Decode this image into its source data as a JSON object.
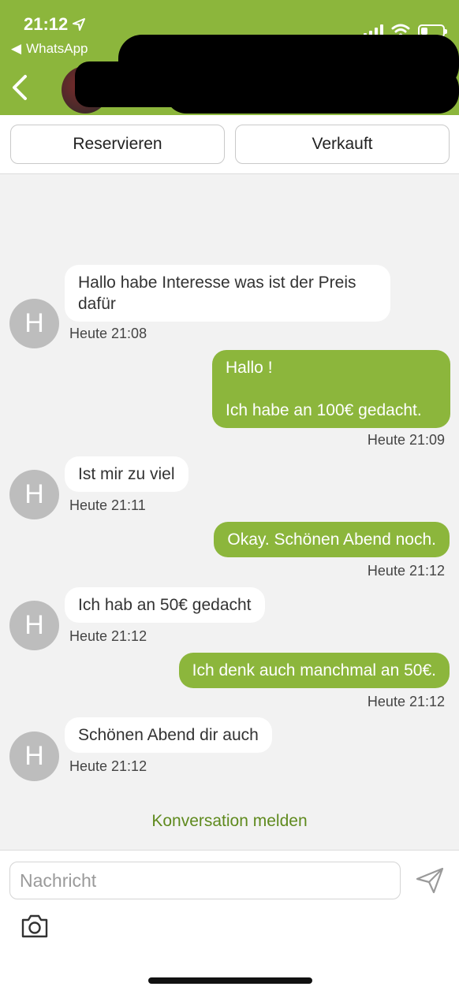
{
  "status": {
    "time": "21:12",
    "back_app": "WhatsApp",
    "battery_level": 0.3
  },
  "colors": {
    "accent": "#8cb63c",
    "report_link": "#5f8a1e"
  },
  "icons": {
    "location": "location-arrow-icon",
    "back": "chevron-left-icon",
    "send": "send-icon",
    "camera": "camera-icon"
  },
  "actions": {
    "reserve_label": "Reservieren",
    "sold_label": "Verkauft"
  },
  "messages": [
    {
      "dir": "in",
      "avatar": "H",
      "text": "Hallo habe Interesse was ist der Preis\ndafür",
      "time": "Heute 21:08"
    },
    {
      "dir": "out",
      "text": "Hallo !\n\nIch habe an 100€ gedacht.",
      "time": "Heute 21:09"
    },
    {
      "dir": "in",
      "avatar": "H",
      "text": "Ist mir zu viel",
      "time": "Heute 21:11"
    },
    {
      "dir": "out",
      "text": "Okay. Schönen Abend noch.",
      "time": "Heute 21:12"
    },
    {
      "dir": "in",
      "avatar": "H",
      "text": "Ich hab an 50€ gedacht",
      "time": "Heute 21:12"
    },
    {
      "dir": "out",
      "text": "Ich denk auch manchmal an 50€.",
      "time": "Heute 21:12"
    },
    {
      "dir": "in",
      "avatar": "H",
      "text": "Schönen Abend dir auch",
      "time": "Heute 21:12"
    }
  ],
  "report_label": "Konversation melden",
  "composer": {
    "placeholder": "Nachricht"
  }
}
